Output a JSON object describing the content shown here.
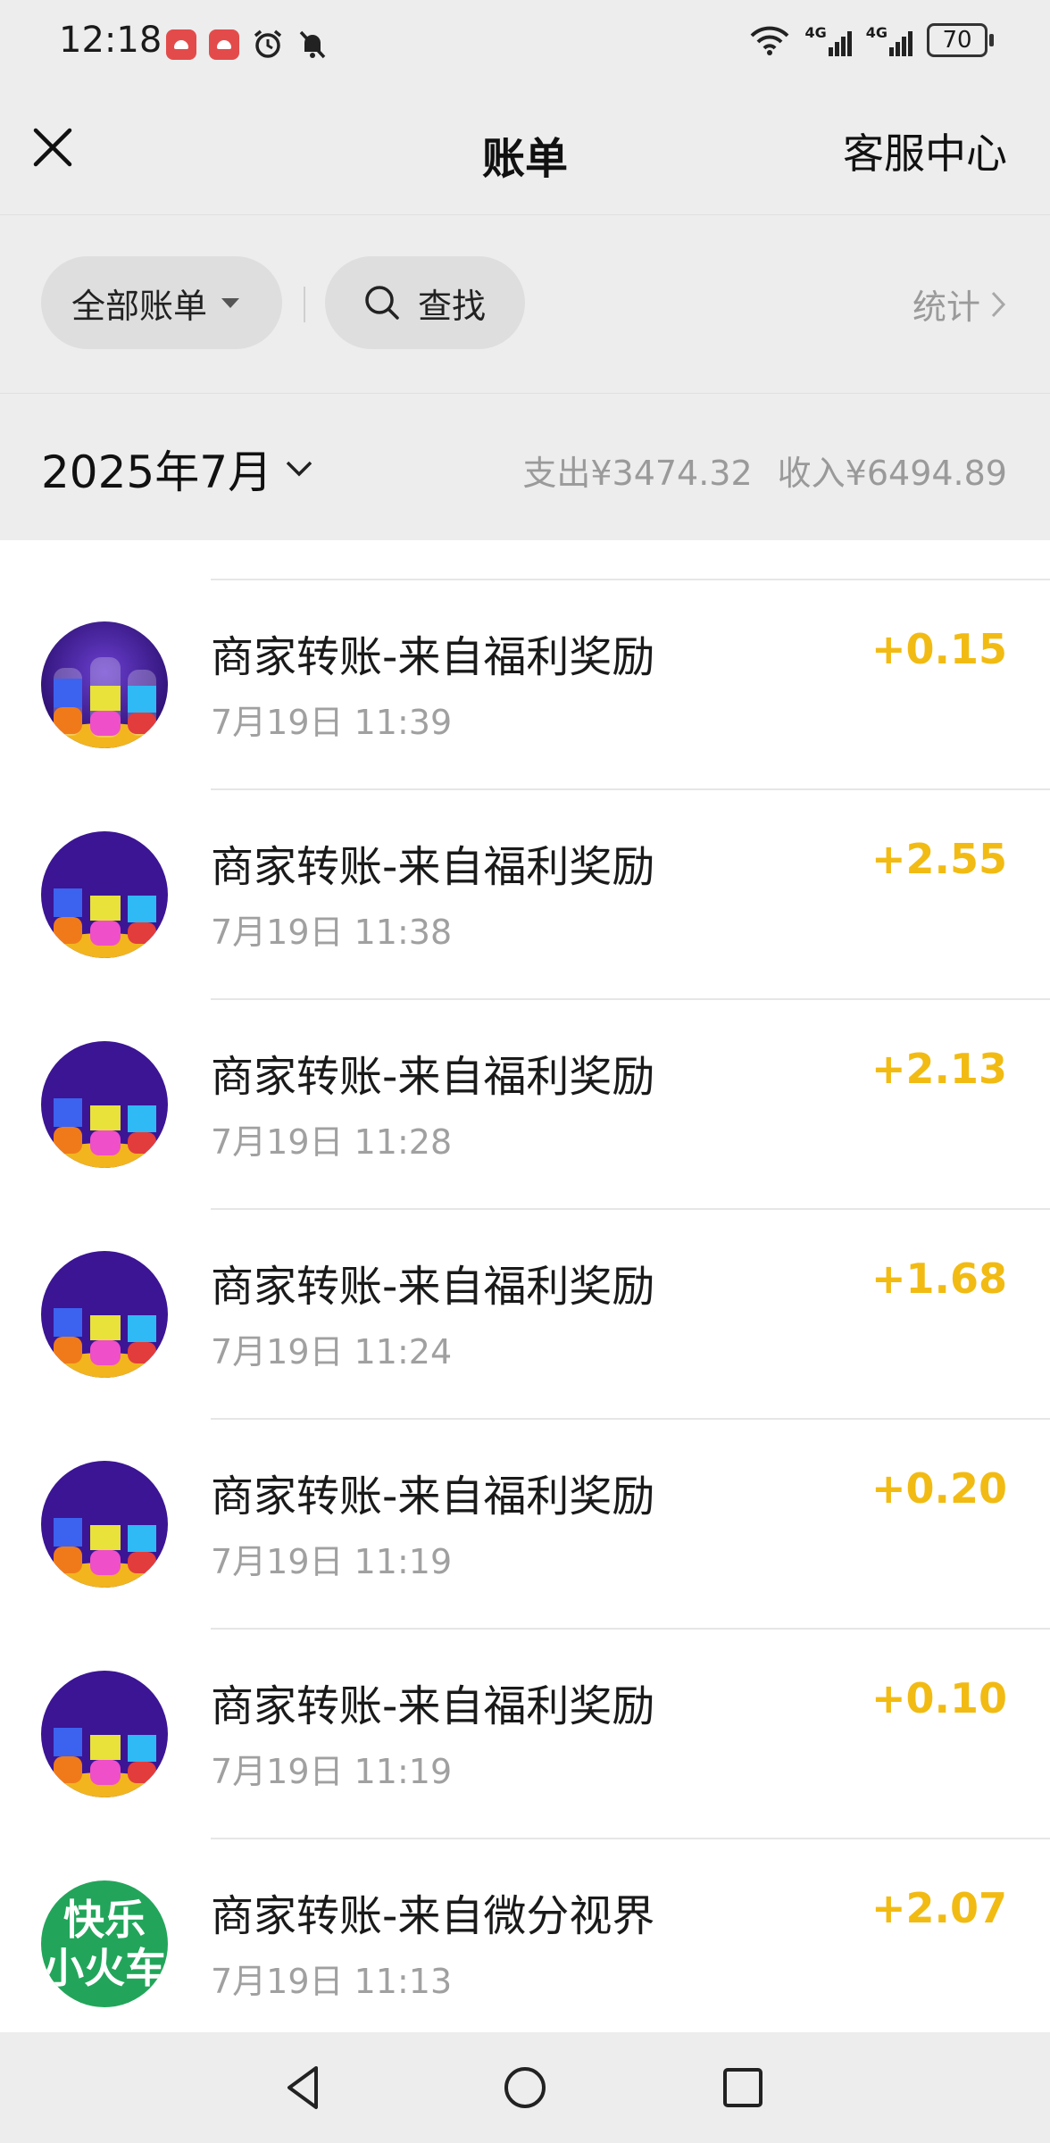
{
  "status_bar": {
    "time": "12:18",
    "network_1": "4G",
    "network_2": "4G",
    "battery": "70"
  },
  "header": {
    "title": "账单",
    "right_link": "客服中心"
  },
  "filters": {
    "all_bills_label": "全部账单",
    "search_label": "查找",
    "stats_label": "统计"
  },
  "month": {
    "label": "2025年7月",
    "expense": "支出¥3474.32",
    "income": "收入¥6494.89"
  },
  "transactions": [
    {
      "title": "商家转账-来自福利奖励",
      "time": "7月19日 11:39",
      "amount": "+0.15",
      "avatar": "water-sort-icon"
    },
    {
      "title": "商家转账-来自福利奖励",
      "time": "7月19日 11:38",
      "amount": "+2.55",
      "avatar": "water-sort-icon"
    },
    {
      "title": "商家转账-来自福利奖励",
      "time": "7月19日 11:28",
      "amount": "+2.13",
      "avatar": "water-sort-icon"
    },
    {
      "title": "商家转账-来自福利奖励",
      "time": "7月19日 11:24",
      "amount": "+1.68",
      "avatar": "water-sort-icon"
    },
    {
      "title": "商家转账-来自福利奖励",
      "time": "7月19日 11:19",
      "amount": "+0.20",
      "avatar": "water-sort-icon"
    },
    {
      "title": "商家转账-来自福利奖励",
      "time": "7月19日 11:19",
      "amount": "+0.10",
      "avatar": "water-sort-icon"
    },
    {
      "title": "商家转账-来自微分视界",
      "time": "7月19日 11:13",
      "amount": "+2.07",
      "avatar": "happy-train-logo",
      "avatar_text_1": "快乐",
      "avatar_text_2": "小火车"
    }
  ],
  "colors": {
    "amount": "#f2bb13",
    "background_gray": "#ededed",
    "secondary_text": "#a0a0a0"
  }
}
